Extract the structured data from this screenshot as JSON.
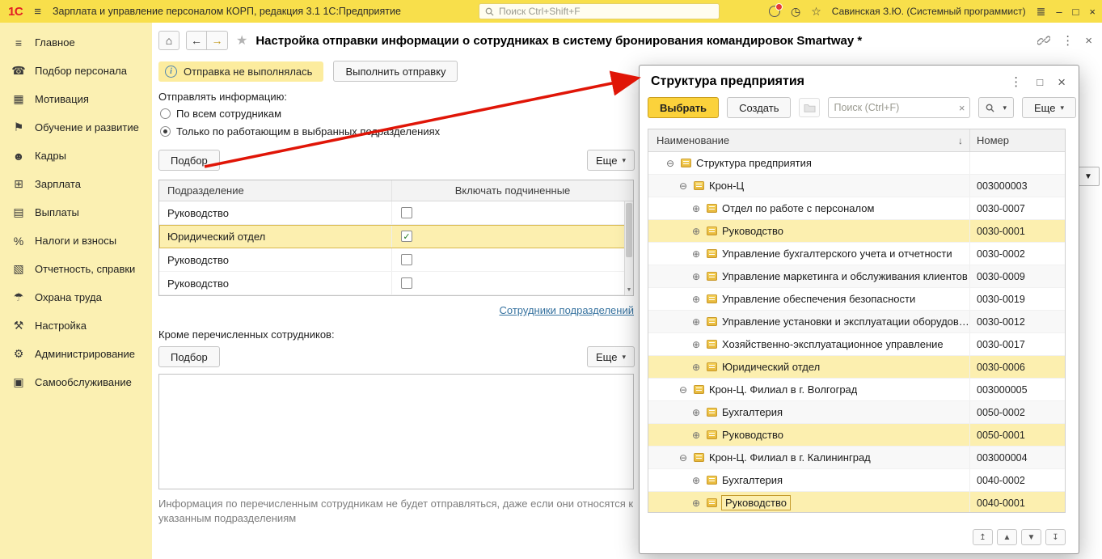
{
  "colors": {
    "topbar_bg": "#F8DF4B",
    "sidebar_bg": "#FBF0B2",
    "highlight": "#FCEFAF",
    "highlight_border": "#D8B84E",
    "badge_bg": "#FCEC9E",
    "select_button_bg": "#FBD23B",
    "select_button_border": "#C99E1E",
    "link": "#36729F",
    "arrow": "#E01507"
  },
  "icon_glyphs": {
    "menu-lines": "≡",
    "hamburger": "≡",
    "phone": "☎",
    "chart": "▦",
    "flag": "⚑",
    "people": "☻",
    "grid": "⊞",
    "payments": "▤",
    "percent": "%",
    "report": "▧",
    "umbrella": "☂",
    "tools": "⚒",
    "gear": "⚙",
    "monitor": "▣",
    "home": "⌂",
    "back": "←",
    "forward": "→",
    "star": "★",
    "star-outline": "☆",
    "clock": "◷",
    "more-vert": "⋮",
    "close": "×",
    "minimize": "–",
    "maximize": "□",
    "dropdown": "▾",
    "sort-desc": "↓",
    "expand-open": "⊖",
    "expand-closed": "⊕",
    "check": "✓",
    "support": "≣",
    "nav-first": "↥",
    "nav-up": "▲",
    "nav-down": "▼",
    "nav-last": "↧"
  },
  "topbar": {
    "logo": "1С",
    "title": "Зарплата и управление персоналом КОРП, редакция 3.1 1С:Предприятие",
    "search_placeholder": "Поиск Ctrl+Shift+F",
    "user": "Савинская З.Ю. (Системный программист)"
  },
  "sidebar": {
    "items": [
      {
        "id": "glavnoe",
        "label": "Главное",
        "icon": "menu-lines"
      },
      {
        "id": "podbor-personala",
        "label": "Подбор персонала",
        "icon": "phone"
      },
      {
        "id": "motivaciya",
        "label": "Мотивация",
        "icon": "chart"
      },
      {
        "id": "obuchenie-i-razvitie",
        "label": "Обучение и развитие",
        "icon": "flag"
      },
      {
        "id": "kadry",
        "label": "Кадры",
        "icon": "people"
      },
      {
        "id": "zarplata",
        "label": "Зарплата",
        "icon": "grid"
      },
      {
        "id": "vyplaty",
        "label": "Выплаты",
        "icon": "payments"
      },
      {
        "id": "nalogi-i-vznosy",
        "label": "Налоги и взносы",
        "icon": "percent"
      },
      {
        "id": "otchetnost-spravki",
        "label": "Отчетность, справки",
        "icon": "report"
      },
      {
        "id": "ohrana-truda",
        "label": "Охрана труда",
        "icon": "umbrella"
      },
      {
        "id": "nastrojka",
        "label": "Настройка",
        "icon": "tools"
      },
      {
        "id": "administrirovanie",
        "label": "Администрирование",
        "icon": "gear"
      },
      {
        "id": "samoobsluzhivanie",
        "label": "Самообслуживание",
        "icon": "monitor"
      }
    ]
  },
  "main": {
    "title": "Настройка отправки информации о сотрудниках в систему бронирования командировок Smartway *",
    "status_badge": "Отправка не выполнялась",
    "send_button": "Выполнить отправку",
    "send_info_label": "Отправлять информацию:",
    "radio_all": "По всем сотрудникам",
    "radio_selected": "Только по работающим в выбранных подразделениях",
    "pick_button": "Подбор",
    "more_button": "Еще",
    "table": {
      "columns": [
        "Подразделение",
        "Включать подчиненные"
      ],
      "rows": [
        {
          "name": "Руководство",
          "checked": false
        },
        {
          "name": "Юридический отдел",
          "checked": true
        },
        {
          "name": "Руководство",
          "checked": false
        },
        {
          "name": "Руководство",
          "checked": false
        }
      ]
    },
    "employees_link": "Сотрудники подразделений",
    "except_label": "Кроме перечисленных сотрудников:",
    "footnote": "Информация по перечисленным сотрудникам не будет отправляться, даже если они относятся к указанным подразделениям"
  },
  "dialog": {
    "title": "Структура предприятия",
    "select_button": "Выбрать",
    "create_button": "Создать",
    "search_placeholder": "Поиск (Ctrl+F)",
    "more_button": "Еще",
    "columns": {
      "name": "Наименование",
      "number": "Номер"
    },
    "rows": [
      {
        "level": 1,
        "expand": "minus",
        "label": "Структура предприятия",
        "number": ""
      },
      {
        "level": 2,
        "expand": "minus",
        "label": "Крон-Ц",
        "number": "003000003"
      },
      {
        "level": 3,
        "expand": "plus",
        "label": "Отдел по работе с персоналом",
        "number": "0030-0007"
      },
      {
        "level": 3,
        "expand": "plus",
        "label": "Руководство",
        "number": "0030-0001",
        "highlight": true
      },
      {
        "level": 3,
        "expand": "plus",
        "label": "Управление бухгалтерского учета и отчетности",
        "number": "0030-0002"
      },
      {
        "level": 3,
        "expand": "plus",
        "label": "Управление маркетинга и обслуживания клиентов",
        "number": "0030-0009"
      },
      {
        "level": 3,
        "expand": "plus",
        "label": "Управление обеспечения безопасности",
        "number": "0030-0019"
      },
      {
        "level": 3,
        "expand": "plus",
        "label": "Управление установки и эксплуатации оборудов…",
        "number": "0030-0012"
      },
      {
        "level": 3,
        "expand": "plus",
        "label": "Хозяйственно-эксплуатационное управление",
        "number": "0030-0017"
      },
      {
        "level": 3,
        "expand": "plus",
        "label": "Юридический отдел",
        "number": "0030-0006",
        "highlight": true
      },
      {
        "level": 2,
        "expand": "minus",
        "label": "Крон-Ц. Филиал в г. Волгоград",
        "number": "003000005"
      },
      {
        "level": 3,
        "expand": "plus",
        "label": "Бухгалтерия",
        "number": "0050-0002"
      },
      {
        "level": 3,
        "expand": "plus",
        "label": "Руководство",
        "number": "0050-0001",
        "highlight": true
      },
      {
        "level": 2,
        "expand": "minus",
        "label": "Крон-Ц. Филиал в г. Калининград",
        "number": "003000004"
      },
      {
        "level": 3,
        "expand": "plus",
        "label": "Бухгалтерия",
        "number": "0040-0002"
      },
      {
        "level": 3,
        "expand": "plus",
        "label": "Руководство",
        "number": "0040-0001",
        "highlight": true,
        "current": true
      }
    ]
  }
}
